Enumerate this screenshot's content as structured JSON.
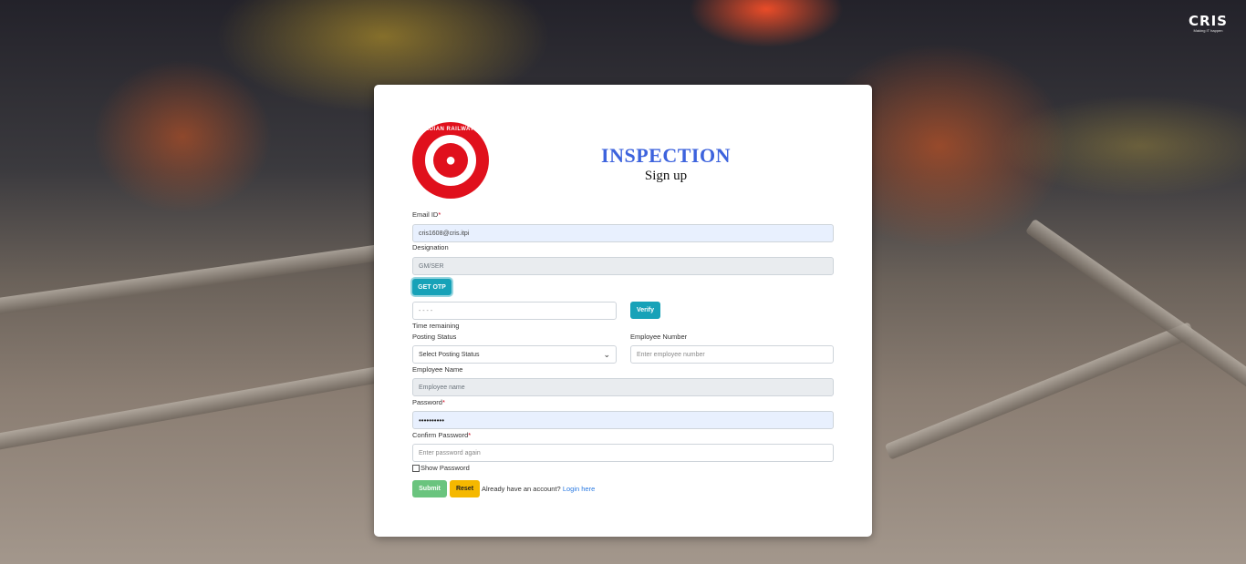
{
  "brand": {
    "logo_text": "CRIS",
    "logo_tagline": "Making IT happen"
  },
  "emblem": {
    "text": "INDIAN RAILWAYS",
    "glyph": "locomotive-icon"
  },
  "header": {
    "title": "INSPECTION",
    "subtitle": "Sign up"
  },
  "form": {
    "email": {
      "label": "Email ID",
      "required": "*",
      "value": "cris1608@cris.itpi"
    },
    "designation": {
      "label": "Designation",
      "value": "GM/SER"
    },
    "get_otp_label": "GET OTP",
    "otp": {
      "placeholder": "- - - -"
    },
    "verify_label": "Verify",
    "time_remaining": "Time remaining",
    "posting_status": {
      "label": "Posting Status",
      "selected": "Select Posting Status"
    },
    "employee_number": {
      "label": "Employee Number",
      "placeholder": "Enter employee number"
    },
    "employee_name": {
      "label": "Employee Name",
      "placeholder": "Employee name"
    },
    "password": {
      "label": "Password",
      "required": "*",
      "value": "••••••••••"
    },
    "confirm_password": {
      "label": "Confirm Password",
      "required": "*",
      "placeholder": "Enter password again"
    },
    "show_password": "Show Password",
    "submit_label": "Submit",
    "reset_label": "Reset",
    "already_text": "Already have an account?",
    "login_link": "Login here"
  },
  "colors": {
    "accent": "#17a2b8",
    "title": "#3d63dd",
    "submit": "#6ac47e",
    "reset": "#f5b800",
    "emblem": "#e0101c"
  }
}
